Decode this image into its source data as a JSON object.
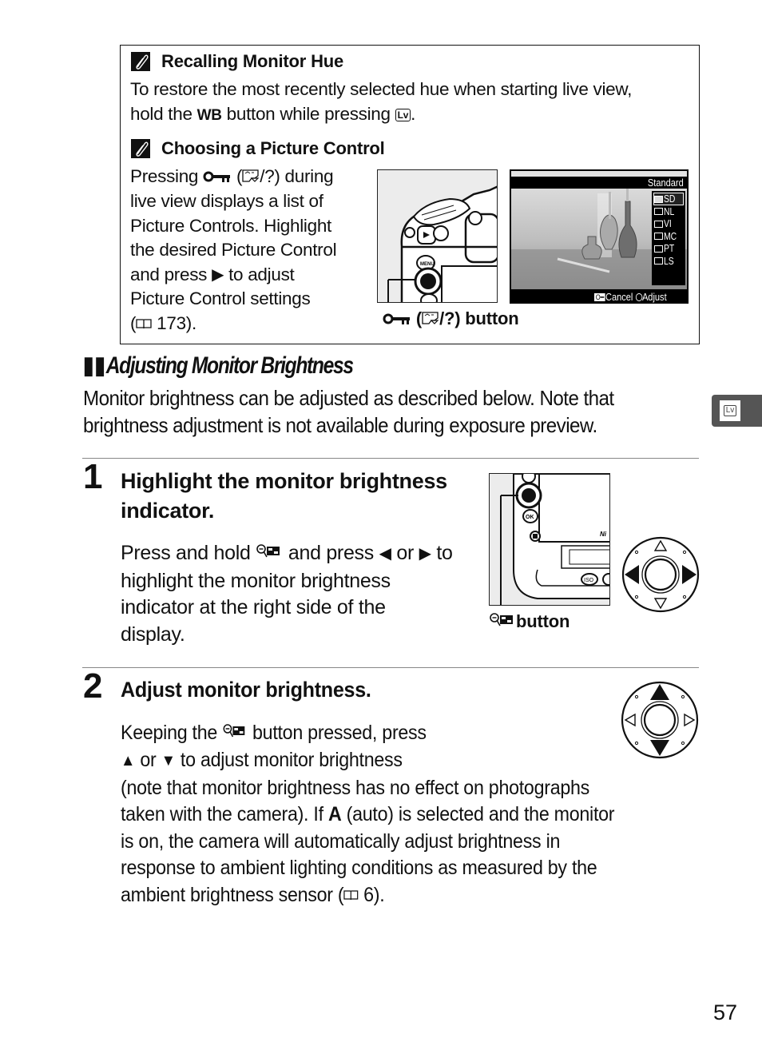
{
  "notes": [
    {
      "icon": "pencil-note-icon",
      "title": "Recalling Monitor Hue",
      "lines": [
        "To restore the most recently selected hue when starting live view,",
        "hold the ",
        "WB",
        " button while pressing ",
        "Lv",
        "."
      ]
    },
    {
      "icon": "pencil-note-icon",
      "title": "Choosing a Picture Control",
      "lines": [
        "Pressing ",
        " (",
        "/?) during",
        "live view displays a list of",
        "Picture Controls.  Highlight",
        "the desired Picture Control",
        "and press ",
        "▶",
        " to adjust",
        "Picture Control settings",
        "(",
        " 173)."
      ],
      "figure_caption": "(",
      "figure_caption_end": "/?) button",
      "lcd": {
        "header": "Standard",
        "items": [
          "SD",
          "NL",
          "VI",
          "MC",
          "PT",
          "LS"
        ],
        "selected": "SD",
        "footer_cancel": "Cancel",
        "footer_adjust": "Adjust"
      }
    }
  ],
  "section": {
    "heading_bars": "▮▮",
    "heading": "Adjusting Monitor Brightness",
    "intro": [
      "Monitor brightness can be adjusted as described below.  Note that",
      "brightness adjustment is not available during exposure preview."
    ]
  },
  "side_tab": {
    "label": "Lv"
  },
  "steps": [
    {
      "number": "1",
      "title": [
        "Highlight the monitor brightness",
        "indicator."
      ],
      "text": {
        "l1a": "Press and hold ",
        "l1b": " and press ",
        "l1c": "◀",
        "l1d": " or ",
        "l1e": "▶",
        "l1f": " to",
        "l2": "highlight the monitor brightness",
        "l3": "indicator at the right side of the",
        "l4": "display."
      },
      "figure_caption": "button",
      "camera_labels": {
        "ok": "OK",
        "iso": "ISO",
        "brand": "Ni"
      }
    },
    {
      "number": "2",
      "title": "Adjust monitor brightness.",
      "text": {
        "l1a": "Keeping the ",
        "l1b": " button pressed, press",
        "l2a": "▲",
        "l2b": " or ",
        "l2c": "▼",
        "l2d": " to adjust monitor brightness",
        "l3": "(note that monitor brightness has no effect on photographs",
        "l4a": "taken with the camera).  If ",
        "l4b": "A",
        "l4c": " (auto) is selected and the monitor",
        "l5": "is on, the camera will automatically adjust brightness in",
        "l6": "response to ambient lighting conditions as measured by the",
        "l7a": "ambient brightness sensor (",
        "l7b": " 6)."
      }
    }
  ],
  "page_number": "57"
}
